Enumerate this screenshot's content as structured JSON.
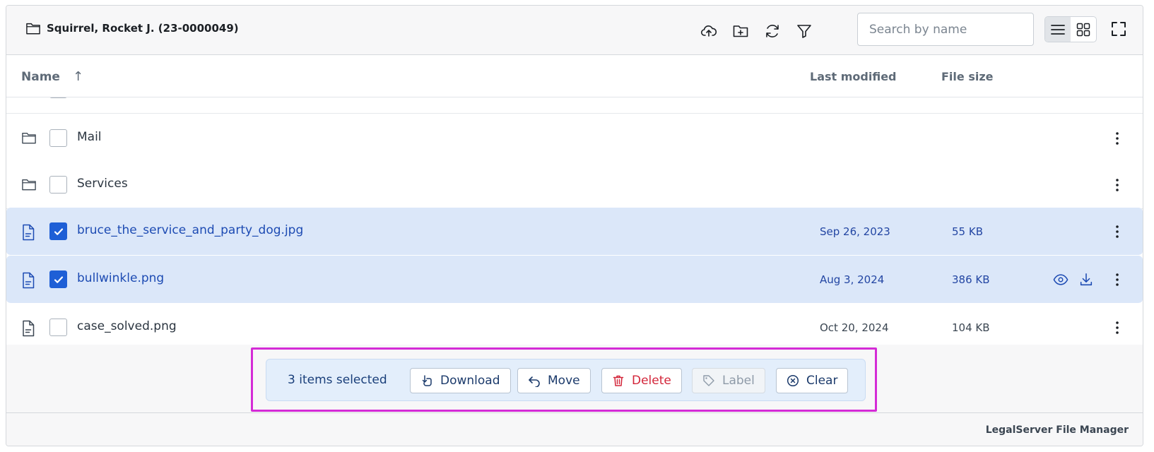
{
  "header": {
    "title": "Squirrel, Rocket J. (23-0000049)",
    "tools": [
      "upload-icon",
      "new-folder-icon",
      "refresh-icon",
      "filter-icon"
    ],
    "search_placeholder": "Search by name",
    "view_modes": [
      "list",
      "grid"
    ],
    "active_view": "list"
  },
  "columns": {
    "name": "Name",
    "sort_indicator": "↑",
    "last_modified": "Last modified",
    "file_size": "File size"
  },
  "rows": [
    {
      "type": "folder",
      "name": "Mail",
      "date": "",
      "size": "",
      "selected": false
    },
    {
      "type": "folder",
      "name": "Services",
      "date": "",
      "size": "",
      "selected": false
    },
    {
      "type": "file",
      "name": "bruce_the_service_and_party_dog.jpg",
      "date": "Sep 26, 2023",
      "size": "55 KB",
      "selected": true
    },
    {
      "type": "file",
      "name": "bullwinkle.png",
      "date": "Aug 3, 2024",
      "size": "386 KB",
      "selected": true,
      "hover_actions": true
    },
    {
      "type": "file",
      "name": "case_solved.png",
      "date": "Oct 20, 2024",
      "size": "104 KB",
      "selected": false
    }
  ],
  "selection_bar": {
    "count_text": "3 items selected",
    "download": "Download",
    "move": "Move",
    "delete": "Delete",
    "label": "Label",
    "clear": "Clear"
  },
  "footer": {
    "brand": "LegalServer File Manager"
  },
  "colors": {
    "accent": "#1e5fd6",
    "selected_row": "#dbe7f9",
    "highlight_box": "#d42bd6",
    "delete": "#d3263a"
  }
}
